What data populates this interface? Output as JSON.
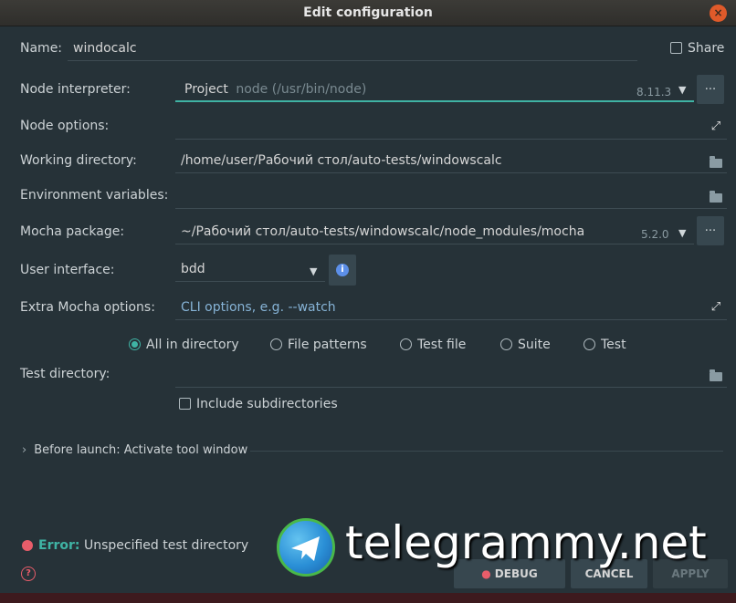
{
  "window": {
    "title": "Edit configuration",
    "close_glyph": "×"
  },
  "form": {
    "name_label": "Name:",
    "name_value": "windocalc",
    "share_label": "Share",
    "node_interpreter_label": "Node interpreter:",
    "node_interpreter_project": "Project",
    "node_interpreter_path": "node (/usr/bin/node)",
    "node_interpreter_version": "8.11.3",
    "node_options_label": "Node options:",
    "working_directory_label": "Working directory:",
    "working_directory_value": "/home/user/Рабочий стол/auto-tests/windowscalc",
    "environment_variables_label": "Environment variables:",
    "mocha_package_label": "Mocha package:",
    "mocha_package_value": "~/Рабочий стол/auto-tests/windowscalc/node_modules/mocha",
    "mocha_package_version": "5.2.0",
    "user_interface_label": "User interface:",
    "user_interface_value": "bdd",
    "extra_mocha_label": "Extra Mocha options:",
    "extra_mocha_placeholder": "CLI options, e.g. --watch",
    "dots_label": "...",
    "info_glyph": "i",
    "expand_glyph": "⤢"
  },
  "scope": {
    "options": [
      {
        "label": "All in directory",
        "checked": true
      },
      {
        "label": "File patterns",
        "checked": false
      },
      {
        "label": "Test file",
        "checked": false
      },
      {
        "label": "Suite",
        "checked": false
      },
      {
        "label": "Test",
        "checked": false
      }
    ],
    "test_directory_label": "Test directory:",
    "include_subdirectories_label": "Include subdirectories"
  },
  "before_launch": {
    "label": "Before launch: Activate tool window",
    "chevron": "›"
  },
  "status": {
    "error_prefix": "Error:",
    "error_message": "Unspecified test directory",
    "help_glyph": "?"
  },
  "buttons": {
    "debug": "DEBUG",
    "cancel": "CANCEL",
    "apply": "APPLY"
  },
  "watermark": {
    "text": "telegrammy.net"
  },
  "colors": {
    "background": "#263238",
    "accent": "#3fb3a4",
    "error": "#e85d6a",
    "placeholder": "#86b3d6"
  }
}
